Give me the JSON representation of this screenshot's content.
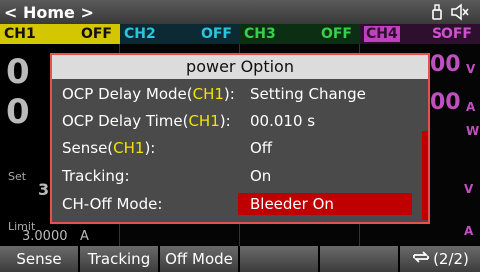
{
  "header": {
    "home_label": "< Home >",
    "icons": [
      "usb-icon",
      "speaker-mute-icon"
    ]
  },
  "channels": [
    {
      "name": "CH1",
      "state": "OFF",
      "color": "#d4c600"
    },
    {
      "name": "CH2",
      "state": "OFF",
      "color": "#2ac6e0"
    },
    {
      "name": "CH3",
      "state": "OFF",
      "color": "#37d04a"
    },
    {
      "name": "CH4",
      "state": "OFF",
      "color": "#d050d0",
      "state_prefix": "S"
    }
  ],
  "background": {
    "ch1_value_top": "0",
    "ch1_value_mid": "0",
    "ch1_set_label": "Set",
    "ch1_set_digit": "3",
    "ch1_limit_label": "Limit",
    "ch1_limit_value": "3.0000",
    "ch1_limit_unit": "A",
    "ch4_value_1": "00",
    "ch4_value_2": "00",
    "ch4_unit_1": "V",
    "ch4_unit_2": "A",
    "ch4_unit_3": "W",
    "ch4_unit_4": "V",
    "ch4_unit_5": "A"
  },
  "dialog": {
    "title": "power Option",
    "rows": [
      {
        "label_pre": "OCP Delay Mode(",
        "label_ch": "CH1",
        "label_post": "):",
        "value": "Setting Change"
      },
      {
        "label_pre": "OCP Delay Time(",
        "label_ch": "CH1",
        "label_post": "):",
        "value": "00.010 s"
      },
      {
        "label_pre": "Sense(",
        "label_ch": "CH1",
        "label_post": "):",
        "value": "Off"
      },
      {
        "label_pre": "Tracking:",
        "label_ch": "",
        "label_post": "",
        "value": "On"
      },
      {
        "label_pre": "CH-Off Mode:",
        "label_ch": "",
        "label_post": "",
        "value": "Bleeder On"
      }
    ],
    "selected_row": 4,
    "highlight_color": "#f2e400",
    "selection_color": "#c00000"
  },
  "softkeys": {
    "k1": "Sense",
    "k2": "Tracking",
    "k3": "Off Mode",
    "k4": "",
    "k5": "",
    "page": "(2/2)"
  }
}
